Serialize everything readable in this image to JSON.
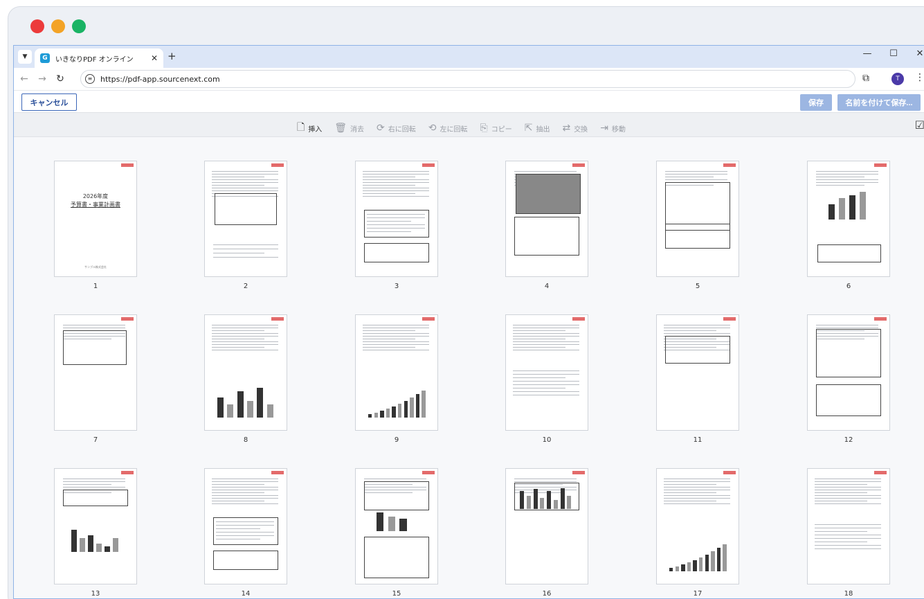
{
  "browser": {
    "tab_title": "いきなりPDF オンライン",
    "url": "https://pdf-app.sourcenext.com",
    "avatar_letter": "T"
  },
  "app": {
    "cancel_label": "キャンセル",
    "save_label": "保存",
    "save_as_label": "名前を付けて保存..."
  },
  "toolbar": {
    "items": [
      {
        "label": "挿入",
        "icon": "insert-icon",
        "enabled": true
      },
      {
        "label": "消去",
        "icon": "trash-icon",
        "enabled": false
      },
      {
        "label": "右に回転",
        "icon": "rotate-right-icon",
        "enabled": false
      },
      {
        "label": "左に回転",
        "icon": "rotate-left-icon",
        "enabled": false
      },
      {
        "label": "コピー",
        "icon": "copy-icon",
        "enabled": false
      },
      {
        "label": "抽出",
        "icon": "extract-icon",
        "enabled": false
      },
      {
        "label": "交換",
        "icon": "replace-icon",
        "enabled": false
      },
      {
        "label": "移動",
        "icon": "move-icon",
        "enabled": false
      }
    ]
  },
  "cover": {
    "title_line1": "2026年度",
    "title_line2": "予算書・事業計画書",
    "footer": "サンプル株式会社"
  },
  "pages": [
    {
      "number": "1"
    },
    {
      "number": "2"
    },
    {
      "number": "3"
    },
    {
      "number": "4"
    },
    {
      "number": "5"
    },
    {
      "number": "6"
    },
    {
      "number": "7"
    },
    {
      "number": "8"
    },
    {
      "number": "9"
    },
    {
      "number": "10"
    },
    {
      "number": "11"
    },
    {
      "number": "12"
    },
    {
      "number": "13"
    },
    {
      "number": "14"
    },
    {
      "number": "15"
    },
    {
      "number": "16"
    },
    {
      "number": "17"
    },
    {
      "number": "18"
    }
  ],
  "colors": {
    "accent": "#3b67b8",
    "disabled_button": "#9cb6e2",
    "close_dot": "#ec3b3b",
    "minimize_dot": "#f3a326",
    "maximize_dot": "#19b364"
  }
}
